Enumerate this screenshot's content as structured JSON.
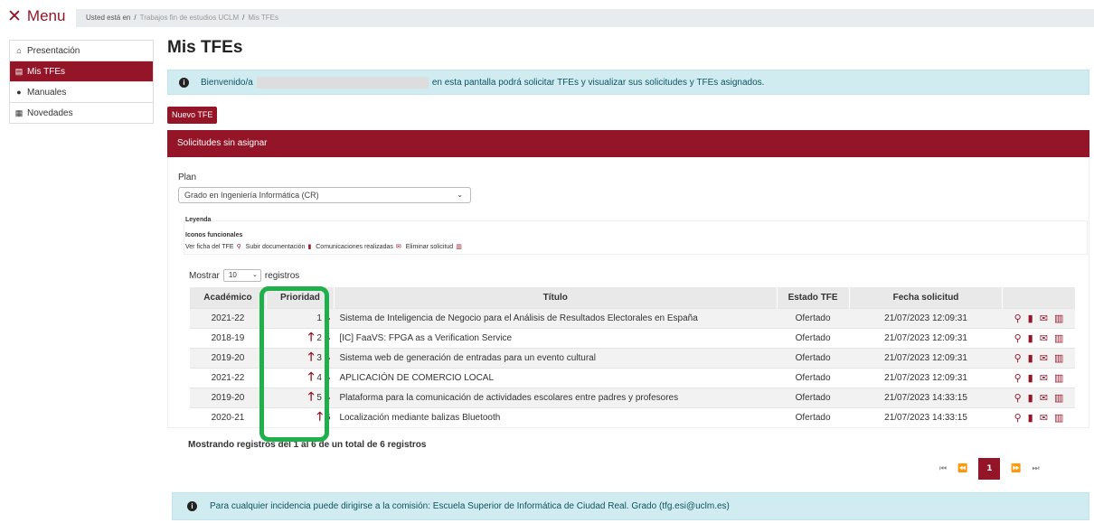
{
  "topbar": {
    "menu_label": "Menu"
  },
  "breadcrumb": {
    "prefix": "Usted está en",
    "items": [
      "Trabajos fin de estudios UCLM",
      "Mis TFEs"
    ]
  },
  "sidebar": {
    "items": [
      {
        "label": "Presentación",
        "icon": "home-icon"
      },
      {
        "label": "Mis TFEs",
        "icon": "file-icon",
        "active": true
      },
      {
        "label": "Manuales",
        "icon": "info-icon"
      },
      {
        "label": "Novedades",
        "icon": "news-icon"
      }
    ]
  },
  "main": {
    "title": "Mis TFEs",
    "welcome_prefix": "Bienvenido/a",
    "welcome_suffix": "en esta pantalla podrá solicitar TFEs y visualizar sus solicitudes y TFEs asignados.",
    "new_button": "Nuevo TFE",
    "card_title": "Solicitudes sin asignar",
    "plan_label": "Plan",
    "plan_value": "Grado en Ingeniería Informática (CR)",
    "legend": {
      "title": "Leyenda",
      "subtitle": "Iconos funcionales",
      "items": [
        "Ver ficha del TFE",
        "Subir documentación",
        "Comunicaciones realizadas",
        "Eliminar solicitud"
      ]
    },
    "show_prefix": "Mostrar",
    "show_value": "10",
    "show_suffix": "registros",
    "table": {
      "headers": [
        "Académico",
        "Prioridad",
        "Título",
        "Estado TFE",
        "Fecha solicitud",
        ""
      ],
      "rows": [
        {
          "academico": "2021-22",
          "prioridad": "1",
          "up": false,
          "down": true,
          "titulo": "Sistema de Inteligencia de Negocio para el Análisis de Resultados Electorales en España",
          "estado": "Ofertado",
          "fecha": "21/07/2023 12:09:31"
        },
        {
          "academico": "2018-19",
          "prioridad": "2",
          "up": true,
          "down": true,
          "titulo": "[IC] FaaVS: FPGA as a Verification Service",
          "estado": "Ofertado",
          "fecha": "21/07/2023 12:09:31"
        },
        {
          "academico": "2019-20",
          "prioridad": "3",
          "up": true,
          "down": true,
          "titulo": "Sistema web de generación de entradas para un evento cultural",
          "estado": "Ofertado",
          "fecha": "21/07/2023 12:09:31"
        },
        {
          "academico": "2021-22",
          "prioridad": "4",
          "up": true,
          "down": true,
          "titulo": "APLICACIÓN DE COMERCIO LOCAL",
          "estado": "Ofertado",
          "fecha": "21/07/2023 12:09:31"
        },
        {
          "academico": "2019-20",
          "prioridad": "5",
          "up": true,
          "down": true,
          "titulo": "Plataforma para la comunicación de actividades escolares entre padres y profesores",
          "estado": "Ofertado",
          "fecha": "21/07/2023 14:33:15"
        },
        {
          "academico": "2020-21",
          "prioridad": "6",
          "up": true,
          "down": false,
          "titulo": "Localización mediante balizas Bluetooth",
          "estado": "Ofertado",
          "fecha": "21/07/2023 14:33:15"
        }
      ]
    },
    "summary": "Mostrando registros del 1 al 6 de un total de 6 registros",
    "pager": {
      "current": "1"
    },
    "footer_info": "Para cualquier incidencia puede dirigirse a la comisión: Escuela Superior de Informática de Ciudad Real. Grado (tfg.esi@uclm.es)"
  },
  "colors": {
    "brand": "#941528",
    "highlight": "#1fb04b",
    "info_bg": "#d1ecf1"
  }
}
